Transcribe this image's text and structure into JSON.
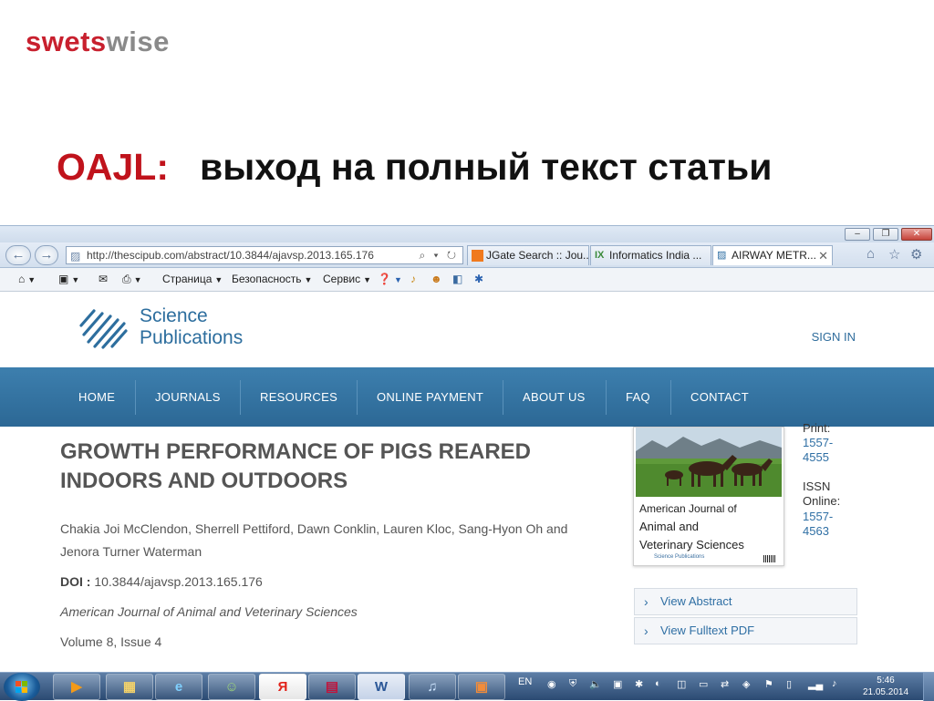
{
  "slide": {
    "brand_part1": "swets",
    "brand_part2": "wise",
    "title_label": "OAJL:",
    "title_text": "выход на полный текст статьи"
  },
  "browser": {
    "url": "http://thescipub.com/abstract/10.3844/ajavsp.2013.165.176",
    "address_controls": "⌕ ▾ ↻",
    "tabs": [
      {
        "label": "JGate Search :: Jou..."
      },
      {
        "label": "Informatics India ..."
      },
      {
        "label": "AIRWAY METR..."
      }
    ],
    "command_bar": {
      "page": "Страница",
      "security": "Безопасность",
      "service": "Сервис"
    }
  },
  "site": {
    "logo_line1": "Science",
    "logo_line2": "Publications",
    "sign_in": "SIGN IN",
    "nav": [
      "HOME",
      "JOURNALS",
      "RESOURCES",
      "ONLINE PAYMENT",
      "ABOUT US",
      "FAQ",
      "CONTACT"
    ]
  },
  "article": {
    "title": "GROWTH PERFORMANCE OF PIGS REARED INDOORS AND OUTDOORS",
    "authors": "Chakia Joi McClendon, Sherrell Pettiford, Dawn Conklin, Lauren Kloc, Sang-Hyon Oh and Jenora Turner Waterman",
    "doi_label": "DOI :",
    "doi": "10.3844/ajavsp.2013.165.176",
    "journal": "American Journal of Animal and Veterinary Sciences",
    "volume": "Volume 8, Issue 4"
  },
  "cover": {
    "line1": "American Journal of",
    "line2": "Animal and",
    "line3": "Veterinary Sciences",
    "publisher": "Science Publications"
  },
  "issn": {
    "print_label": "Print:",
    "print_1": "1557-",
    "print_2": "4555",
    "online_label_1": "ISSN",
    "online_label_2": "Online:",
    "online_1": "1557-",
    "online_2": "4563"
  },
  "links": {
    "view_abstract": "View Abstract",
    "view_fulltext": "View Fulltext PDF"
  },
  "taskbar": {
    "yandex_label": "Я",
    "word_label": "W",
    "lang": "EN",
    "time": "5:46",
    "date": "21.05.2014"
  },
  "colors": {
    "brand_red": "#c8202e",
    "nav_blue": "#336f9c",
    "link_blue": "#2f6fa4"
  }
}
